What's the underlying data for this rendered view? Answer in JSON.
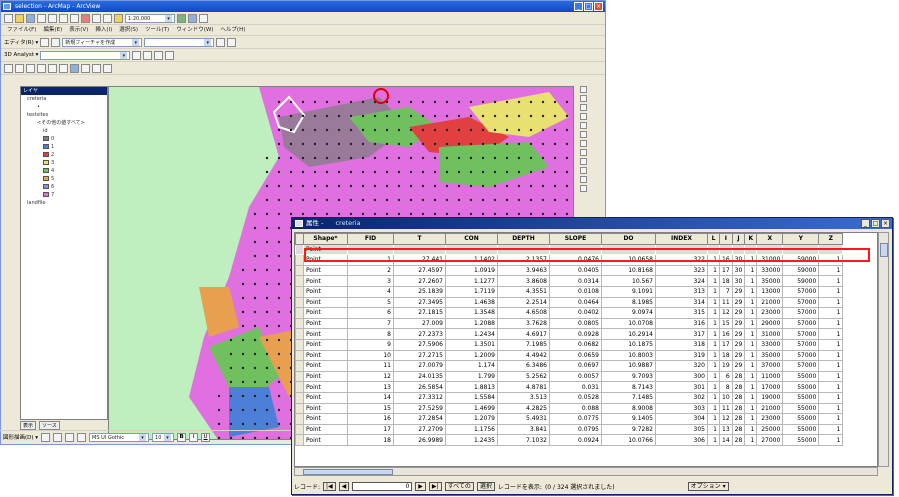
{
  "app": {
    "title": "selection - ArcMap - ArcView"
  },
  "toolbar1": {
    "scale": "1:20,000"
  },
  "menu": [
    "ファイル(F)",
    "編集(E)",
    "表示(V)",
    "挿入(I)",
    "選択(S)",
    "ツール(T)",
    "ウィンドウ(W)",
    "ヘルプ(H)"
  ],
  "editor": {
    "label": "エディタ(R) ▾",
    "task": "新規フィーチャを作成"
  },
  "analyst": {
    "label": "3D Analyst ▾"
  },
  "toc": {
    "title": "レイヤ",
    "rows": [
      {
        "label": "レイヤ",
        "indent": 2,
        "sel": true
      },
      {
        "label": "creteria",
        "indent": 6
      },
      {
        "label": "•",
        "indent": 16
      },
      {
        "label": "testsites",
        "indent": 6
      },
      {
        "label": "<その他の値すべて>",
        "indent": 16
      },
      {
        "label": "id",
        "indent": 22
      },
      {
        "label": "0",
        "indent": 22,
        "color": "#7f7f7f"
      },
      {
        "label": "1",
        "indent": 22,
        "color": "#4e7fd8"
      },
      {
        "label": "2",
        "indent": 22,
        "color": "#e04040"
      },
      {
        "label": "3",
        "indent": 22,
        "color": "#e8e070"
      },
      {
        "label": "4",
        "indent": 22,
        "color": "#70c060"
      },
      {
        "label": "5",
        "indent": 22,
        "color": "#e8a050"
      },
      {
        "label": "6",
        "indent": 22,
        "color": "#9090e0"
      },
      {
        "label": "7",
        "indent": 22,
        "color": "#e070e0"
      },
      {
        "label": "landfile",
        "indent": 6
      },
      {
        "label": "",
        "indent": 16
      }
    ],
    "foot": [
      "表示",
      "ソース"
    ]
  },
  "bottomtb": {
    "draw": "図形描画(D) ▾",
    "font": "MS UI Gothic",
    "size": "10"
  },
  "attrs": {
    "title": "属性 - ",
    "layer": "creteria",
    "columns": [
      "Shape*",
      "FID",
      "T",
      "CON",
      "DEPTH",
      "SLOPE",
      "DO",
      "INDEX",
      "L",
      "I",
      "J",
      "K",
      "X",
      "Y",
      "Z"
    ],
    "rows": [
      [
        "Point",
        "",
        "",
        "",
        "",
        "",
        "",
        "",
        "",
        "",
        "",
        "",
        "",
        "",
        ""
      ],
      [
        "Point",
        "1",
        "27.441",
        "1.1402",
        "2.1357",
        "0.0476",
        "10.0658",
        "322",
        "1",
        "16",
        "30",
        "1",
        "31000",
        "59000",
        "1"
      ],
      [
        "Point",
        "2",
        "27.4597",
        "1.0919",
        "3.9463",
        "0.0405",
        "10.8168",
        "323",
        "1",
        "17",
        "30",
        "1",
        "33000",
        "59000",
        "1"
      ],
      [
        "Point",
        "3",
        "27.2607",
        "1.1277",
        "3.8608",
        "0.0314",
        "10.567",
        "324",
        "1",
        "18",
        "30",
        "1",
        "35000",
        "59000",
        "1"
      ],
      [
        "Point",
        "4",
        "25.1839",
        "1.7119",
        "4.3551",
        "0.0108",
        "9.1091",
        "313",
        "1",
        "7",
        "29",
        "1",
        "13000",
        "57000",
        "1"
      ],
      [
        "Point",
        "5",
        "27.3495",
        "1.4638",
        "2.2514",
        "0.0464",
        "8.1985",
        "314",
        "1",
        "11",
        "29",
        "1",
        "21000",
        "57000",
        "1"
      ],
      [
        "Point",
        "6",
        "27.1815",
        "1.3548",
        "4.6508",
        "0.0402",
        "9.0974",
        "315",
        "1",
        "12",
        "29",
        "1",
        "23000",
        "57000",
        "1"
      ],
      [
        "Point",
        "7",
        "27.009",
        "1.2088",
        "3.7628",
        "0.0805",
        "10.0708",
        "316",
        "1",
        "15",
        "29",
        "1",
        "29000",
        "57000",
        "1"
      ],
      [
        "Point",
        "8",
        "27.2373",
        "1.2434",
        "4.6917",
        "0.0928",
        "10.2914",
        "317",
        "1",
        "16",
        "29",
        "1",
        "31000",
        "57000",
        "1"
      ],
      [
        "Point",
        "9",
        "27.5906",
        "1.3501",
        "7.1985",
        "0.0682",
        "10.1875",
        "318",
        "1",
        "17",
        "29",
        "1",
        "33000",
        "57000",
        "1"
      ],
      [
        "Point",
        "10",
        "27.2715",
        "1.2009",
        "4.4942",
        "0.0659",
        "10.8003",
        "319",
        "1",
        "18",
        "29",
        "1",
        "35000",
        "57000",
        "1"
      ],
      [
        "Point",
        "11",
        "27.0079",
        "1.174",
        "6.3486",
        "0.0697",
        "10.9887",
        "320",
        "1",
        "19",
        "29",
        "1",
        "37000",
        "57000",
        "1"
      ],
      [
        "Point",
        "12",
        "24.0135",
        "1.799",
        "5.2562",
        "0.0057",
        "9.7093",
        "300",
        "1",
        "6",
        "28",
        "1",
        "11000",
        "55000",
        "1"
      ],
      [
        "Point",
        "13",
        "26.5854",
        "1.8813",
        "4.8781",
        "0.031",
        "8.7143",
        "301",
        "1",
        "8",
        "28",
        "1",
        "17000",
        "55000",
        "1"
      ],
      [
        "Point",
        "14",
        "27.3312",
        "1.5584",
        "3.513",
        "0.0528",
        "7.1485",
        "302",
        "1",
        "10",
        "28",
        "1",
        "19000",
        "55000",
        "1"
      ],
      [
        "Point",
        "15",
        "27.5259",
        "1.4699",
        "4.2825",
        "0.088",
        "8.9008",
        "303",
        "1",
        "11",
        "28",
        "1",
        "21000",
        "55000",
        "1"
      ],
      [
        "Point",
        "16",
        "27.2854",
        "1.2079",
        "5.4931",
        "0.0775",
        "9.1405",
        "304",
        "1",
        "12",
        "28",
        "1",
        "23000",
        "55000",
        "1"
      ],
      [
        "Point",
        "17",
        "27.2709",
        "1.1756",
        "3.841",
        "0.0795",
        "9.7282",
        "305",
        "1",
        "13",
        "28",
        "1",
        "25000",
        "55000",
        "1"
      ],
      [
        "Point",
        "18",
        "26.9989",
        "1.2435",
        "7.1032",
        "0.0924",
        "10.0766",
        "306",
        "1",
        "14",
        "28",
        "1",
        "27000",
        "55000",
        "1"
      ]
    ],
    "recbar": {
      "label": "レコード:",
      "value": "0",
      "all": "すべての",
      "sel": "選択",
      "show": "レコードを表示:",
      "count": "(0 / 324 選択されました)",
      "opt": "オプション ▾"
    }
  }
}
